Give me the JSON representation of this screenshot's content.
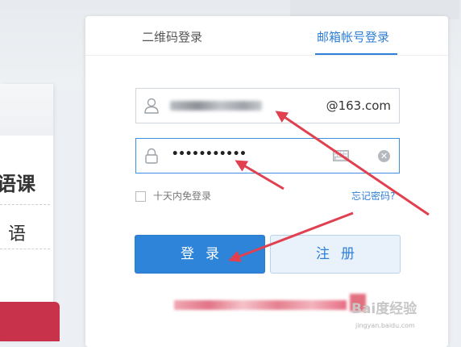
{
  "background": {
    "side_text_1": "语课",
    "side_text_2": "语"
  },
  "tabs": {
    "qr_label": "二维码登录",
    "mail_label": "邮箱帐号登录"
  },
  "username": {
    "domain_suffix": "@163.com"
  },
  "password": {
    "masked_value": "•••••••••••"
  },
  "remember": {
    "label": "十天内免登录"
  },
  "forgot": {
    "label": "忘记密码?"
  },
  "buttons": {
    "login_label": "登录",
    "register_label": "注册"
  },
  "watermark": {
    "text": "Bai度经验",
    "sub": "jingyan.baidu.com"
  },
  "colors": {
    "accent": "#2d84d8",
    "arrow": "#e04050",
    "brand_red": "#c8334b"
  },
  "icons": [
    "user-icon",
    "lock-icon",
    "keyboard-icon",
    "clear-icon"
  ]
}
